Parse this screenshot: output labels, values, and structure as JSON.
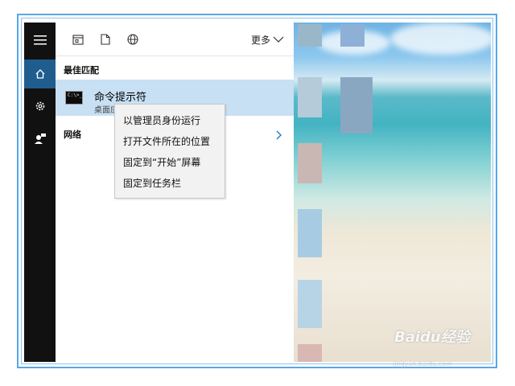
{
  "toolbar": {
    "more_label": "更多"
  },
  "sections": {
    "best_match": "最佳匹配",
    "network": "网络"
  },
  "result": {
    "title": "命令提示符",
    "subtitle": "桌面应用",
    "icon_text": "C:\\>_"
  },
  "context_menu": {
    "items": [
      "以管理员身份运行",
      "打开文件所在的位置",
      "固定到“开始”屏幕",
      "固定到任务栏"
    ]
  },
  "watermark": {
    "brand": "Baidu经验",
    "url": "jingyan.baidu.com"
  },
  "colors": {
    "rail_bg": "#111111",
    "rail_active": "#1f5d8f",
    "result_highlight": "#c8e0f4",
    "frame": "#5aa6e6"
  }
}
